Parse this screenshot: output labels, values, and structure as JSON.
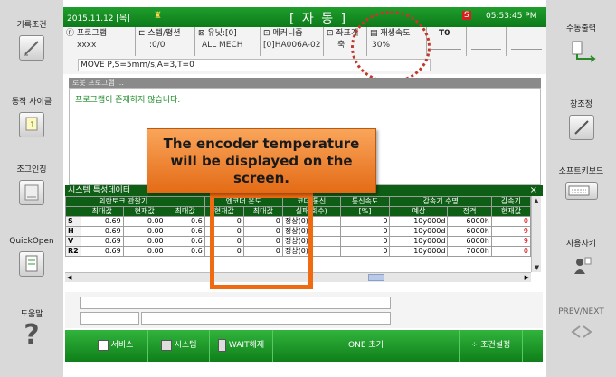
{
  "left_sidebar": {
    "items": [
      {
        "label": "기록조건",
        "icon": "pencil-icon"
      },
      {
        "label": "동작 사이클",
        "icon": "cycle-1-icon"
      },
      {
        "label": "조그인칭",
        "icon": "jog-icon"
      },
      {
        "label": "QuickOpen",
        "icon": "file-icon"
      },
      {
        "label": "도움말",
        "icon": "help-icon",
        "glyph": "?"
      }
    ]
  },
  "right_sidebar": {
    "items": [
      {
        "label": "수동출력",
        "icon": "output-icon"
      },
      {
        "label": "창조정",
        "icon": "window-resize-icon"
      },
      {
        "label": "소프트키보드",
        "icon": "keyboard-icon"
      },
      {
        "label": "사용자키",
        "icon": "user-key-icon"
      },
      {
        "label": "PREV/NEXT",
        "icon": "prev-next-icon"
      }
    ]
  },
  "status_bar": {
    "datetime": "2015.11.12 [목]",
    "mode": "[ 자   동 ]",
    "badge": "S",
    "time": "05:53:45 PM"
  },
  "info_strip": {
    "program_label": "프로그램",
    "program_value": "xxxx",
    "step_label": "스텝/평션",
    "step_value": ":0/0",
    "unit_label": "유닛:[0]",
    "unit_value": "ALL MECH",
    "mechanism_label": "메커니즘",
    "mechanism_value": "[0]HA006A-02",
    "coord_label": "좌표계",
    "coord_value": "축",
    "speed_label": "재생속도",
    "speed_value": "30%",
    "tool_label": "T0",
    "command": "MOVE P,S=5mm/s,A=3,T=0"
  },
  "robot_program": {
    "title": "로봇 프로그램 ...",
    "message": "프로그램이 존재하지 않습니다."
  },
  "system_data": {
    "title": "시스템 특성데이터",
    "close": "×",
    "group_headers": [
      "외란토크 관찰기",
      "엔코더 온도",
      "인코더 통신",
      "인코더 통신",
      "감속기 수명",
      "감속기"
    ],
    "group_headers_visible": [
      "외란토크 관찰기",
      "엔코더 온도",
      "코더 통신",
      "통신속도",
      "감속기 수명",
      "감속기"
    ],
    "sub_headers": [
      "최대값",
      "현재값",
      "최대값",
      "현재값",
      "최대값",
      "실패 회수)",
      "[%]",
      "예상",
      "정격",
      "현재값"
    ],
    "rows": [
      {
        "axis": "S",
        "v": [
          "0.69",
          "0.00",
          "0.6",
          "0",
          "0",
          "정상(0)",
          "0",
          "10y000d",
          "6000h",
          "0"
        ]
      },
      {
        "axis": "H",
        "v": [
          "0.69",
          "0.00",
          "0.6",
          "0",
          "0",
          "정상(0)",
          "0",
          "10y000d",
          "6000h",
          "9"
        ]
      },
      {
        "axis": "V",
        "v": [
          "0.69",
          "0.00",
          "0.6",
          "0",
          "0",
          "정상(0)",
          "0",
          "10y000d",
          "6000h",
          "9"
        ]
      },
      {
        "axis": "R2",
        "v": [
          "0.69",
          "0.00",
          "0.6",
          "0",
          "0",
          "정상(0)",
          "0",
          "10y000d",
          "7000h",
          "0"
        ]
      }
    ]
  },
  "callout": {
    "text": "The encoder temperature will be displayed on the screen."
  },
  "bottom_bar": {
    "buttons": [
      {
        "label": "서비스",
        "icon": "service-icon"
      },
      {
        "label": "시스템",
        "icon": "system-icon"
      },
      {
        "label": "WAIT해제",
        "icon": "wait-icon"
      },
      {
        "label": "ONE 초기",
        "icon": ""
      },
      {
        "label": "조건설정",
        "icon": "settings-icon"
      }
    ]
  },
  "colors": {
    "green": "#1d9a2a",
    "highlight_red": "#c0392b",
    "orange_box": "#f06a12",
    "callout_orange": "#f29a4a"
  }
}
